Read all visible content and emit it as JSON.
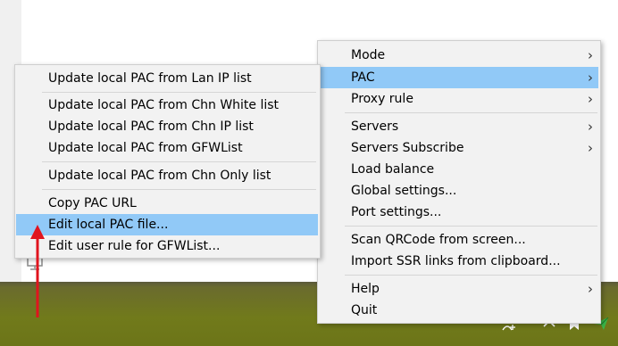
{
  "main_menu": {
    "items": [
      {
        "label": "Mode",
        "submenu": true
      },
      {
        "label": "PAC",
        "submenu": true,
        "highlighted": true
      },
      {
        "label": "Proxy rule",
        "submenu": true
      },
      {
        "label": "Servers",
        "submenu": true
      },
      {
        "label": "Servers Subscribe",
        "submenu": true
      },
      {
        "label": "Load balance"
      },
      {
        "label": "Global settings..."
      },
      {
        "label": "Port settings..."
      },
      {
        "label": "Scan QRCode from screen..."
      },
      {
        "label": "Import SSR links from clipboard..."
      },
      {
        "label": "Help",
        "submenu": true
      },
      {
        "label": "Quit"
      }
    ]
  },
  "pac_menu": {
    "items": [
      {
        "label": "Update local PAC from Lan IP list"
      },
      {
        "label": "Update local PAC from Chn White list"
      },
      {
        "label": "Update local PAC from Chn IP list"
      },
      {
        "label": "Update local PAC from GFWList"
      },
      {
        "label": "Update local PAC from Chn Only list"
      },
      {
        "label": "Copy PAC URL"
      },
      {
        "label": "Edit local PAC file...",
        "highlighted": true
      },
      {
        "label": "Edit user rule for GFWList..."
      }
    ]
  },
  "chevron_glyph": "›",
  "colors": {
    "menu_bg": "#f2f2f2",
    "highlight": "#91c9f7",
    "annotation_arrow": "#e0141e",
    "taskbar": "#717a1b"
  }
}
